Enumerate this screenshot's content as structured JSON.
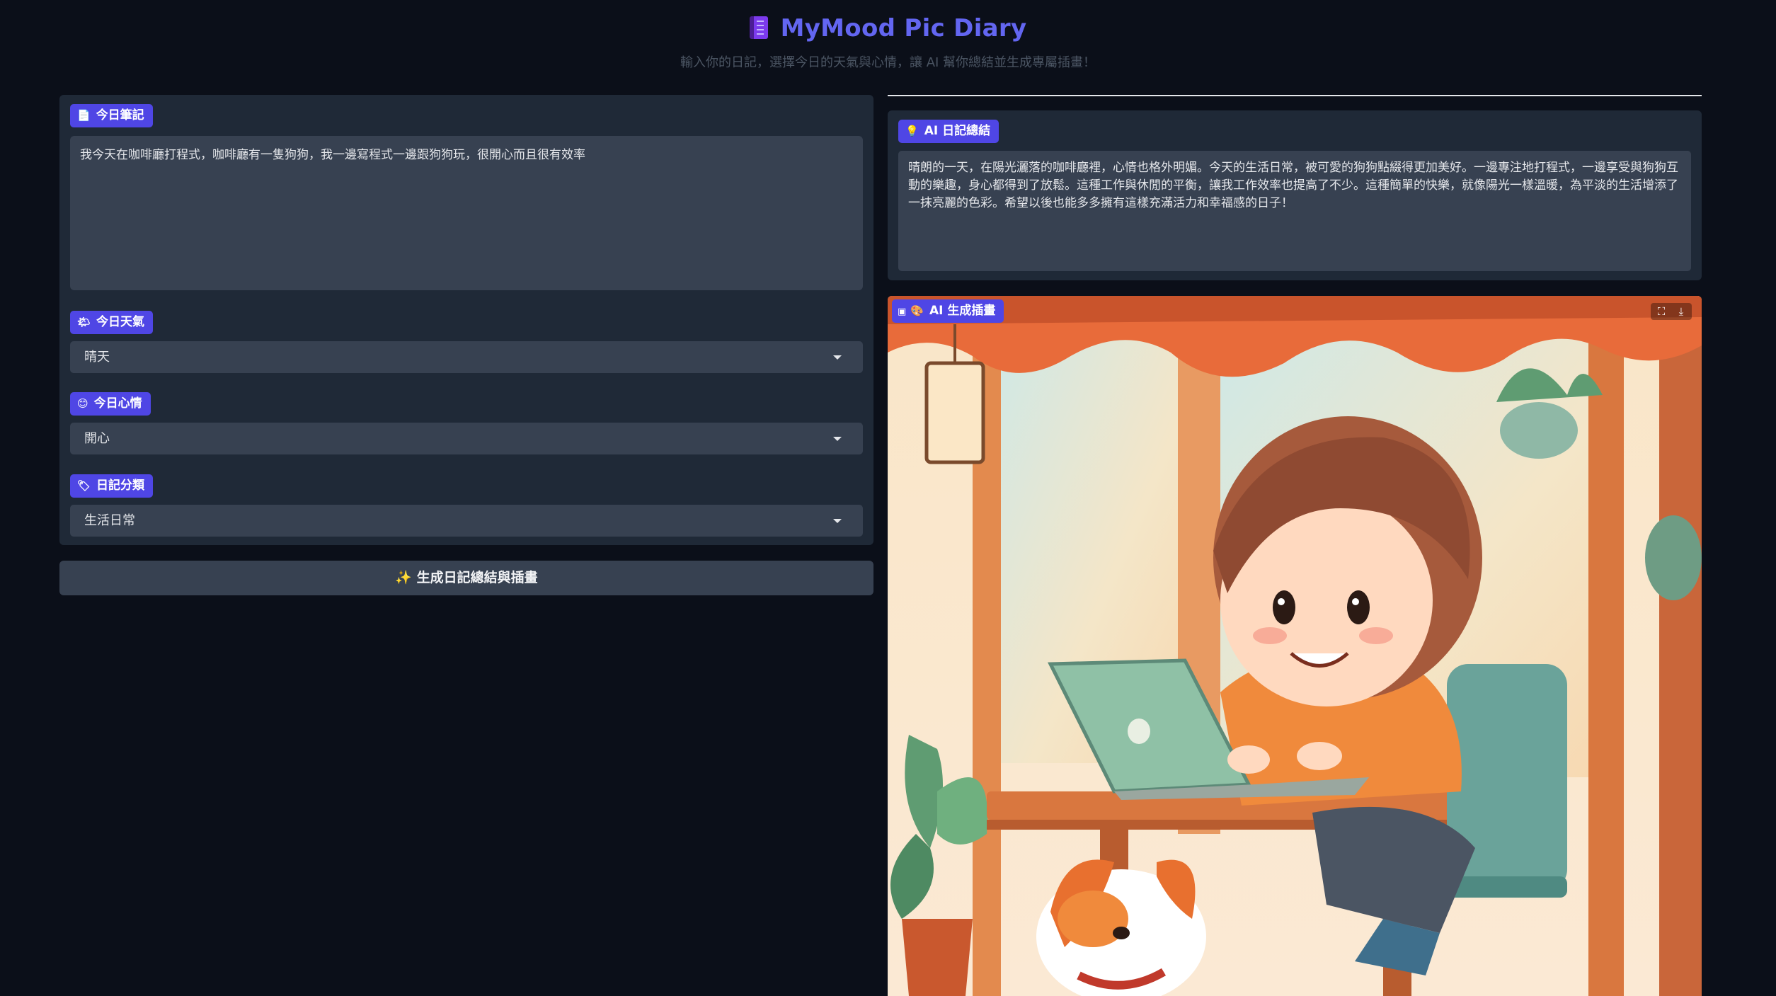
{
  "header": {
    "title": "MyMood Pic Diary",
    "subtitle": "輸入你的日記，選擇今日的天氣與心情，讓 AI 幫你總結並生成專屬插畫！"
  },
  "form": {
    "notes_label": "今日筆記",
    "notes_value": "我今天在咖啡廳打程式，咖啡廳有一隻狗狗，我一邊寫程式一邊跟狗狗玩，很開心而且很有效率",
    "weather_label": "今日天氣",
    "weather_value": "晴天",
    "mood_label": "今日心情",
    "mood_value": "開心",
    "category_label": "日記分類",
    "category_value": "生活日常"
  },
  "generate_button": "✨ 生成日記總結與插畫",
  "summary": {
    "label": "AI 日記總結",
    "text": "晴朗的一天，在陽光灑落的咖啡廳裡，心情也格外明媚。今天的生活日常，被可愛的狗狗點綴得更加美好。一邊專注地打程式，一邊享受與狗狗互動的樂趣，身心都得到了放鬆。這種工作與休閒的平衡，讓我工作效率也提高了不少。這種簡單的快樂，就像陽光一樣溫暖，為平淡的生活增添了一抹亮麗的色彩。希望以後也能多多擁有這樣充滿活力和幸福感的日子！"
  },
  "image": {
    "label": "AI 生成插畫"
  },
  "icons": {
    "title": "notebook-icon",
    "notes": "memo-icon",
    "weather": "sun-cloud-icon",
    "mood": "smiley-icon",
    "category": "tag-icon",
    "summary": "lightbulb-icon",
    "image": "palette-icon",
    "fullscreen": "fullscreen-icon",
    "download": "download-icon"
  },
  "colors": {
    "accent": "#6366f1",
    "badge": "#4f46e5",
    "background": "#0b0f19",
    "panel": "#1f2937",
    "input": "#374151"
  }
}
